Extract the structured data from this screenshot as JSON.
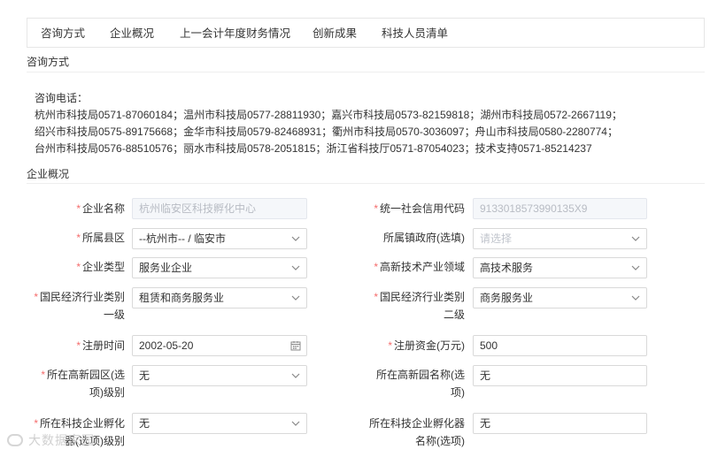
{
  "tabs": [
    "咨询方式",
    "企业概况",
    "上一会计年度财务情况",
    "创新成果",
    "科技人员清单"
  ],
  "sections": {
    "contact_title": "咨询方式",
    "profile_title": "企业概况"
  },
  "contact": {
    "heading": "咨询电话：",
    "line1": "杭州市科技局0571-87060184；温州市科技局0577-28811930；嘉兴市科技局0573-82159818；湖州市科技局0572-2667119；",
    "line2": "绍兴市科技局0575-89175668；金华市科技局0579-82468931；衢州市科技局0570-3036097；舟山市科技局0580-2280774；",
    "line3": "台州市科技局0576-88510576；丽水市科技局0578-2051815；浙江省科技厅0571-87054023；技术支持0571-85214237"
  },
  "form": {
    "company_name": {
      "label": "企业名称",
      "value": "杭州临安区科技孵化中心"
    },
    "credit_code": {
      "label": "统一社会信用代码",
      "value": "9133018573990135X9"
    },
    "county": {
      "label": "所属县区",
      "value": "--杭州市-- / 临安市"
    },
    "town_gov": {
      "label": "所属镇政府(选填)",
      "placeholder": "请选择"
    },
    "company_type": {
      "label": "企业类型",
      "value": "服务业企业"
    },
    "hightech_field": {
      "label": "高新技术产业领域",
      "value": "高技术服务"
    },
    "industry_l1": {
      "label_a": "国民经济行业类别",
      "label_b": "一级",
      "value": "租赁和商务服务业"
    },
    "industry_l2": {
      "label_a": "国民经济行业类别",
      "label_b": "二级",
      "value": "商务服务业"
    },
    "reg_date": {
      "label": "注册时间",
      "value": "2002-05-20"
    },
    "reg_capital": {
      "label": "注册资金(万元)",
      "value": "500"
    },
    "park_level": {
      "label_a": "所在高新园区(选",
      "label_b": "项)级别",
      "value": "无"
    },
    "park_name": {
      "label_a": "所在高新园名称(选",
      "label_b": "项)",
      "value": "无"
    },
    "incubator_level": {
      "label_a": "所在科技企业孵化",
      "label_b": "器(选项)级别",
      "value": "无"
    },
    "incubator_name": {
      "label_a": "所在科技企业孵化器",
      "label_b": "名称(选项)",
      "value": "无"
    }
  },
  "watermark": "大数据家园"
}
